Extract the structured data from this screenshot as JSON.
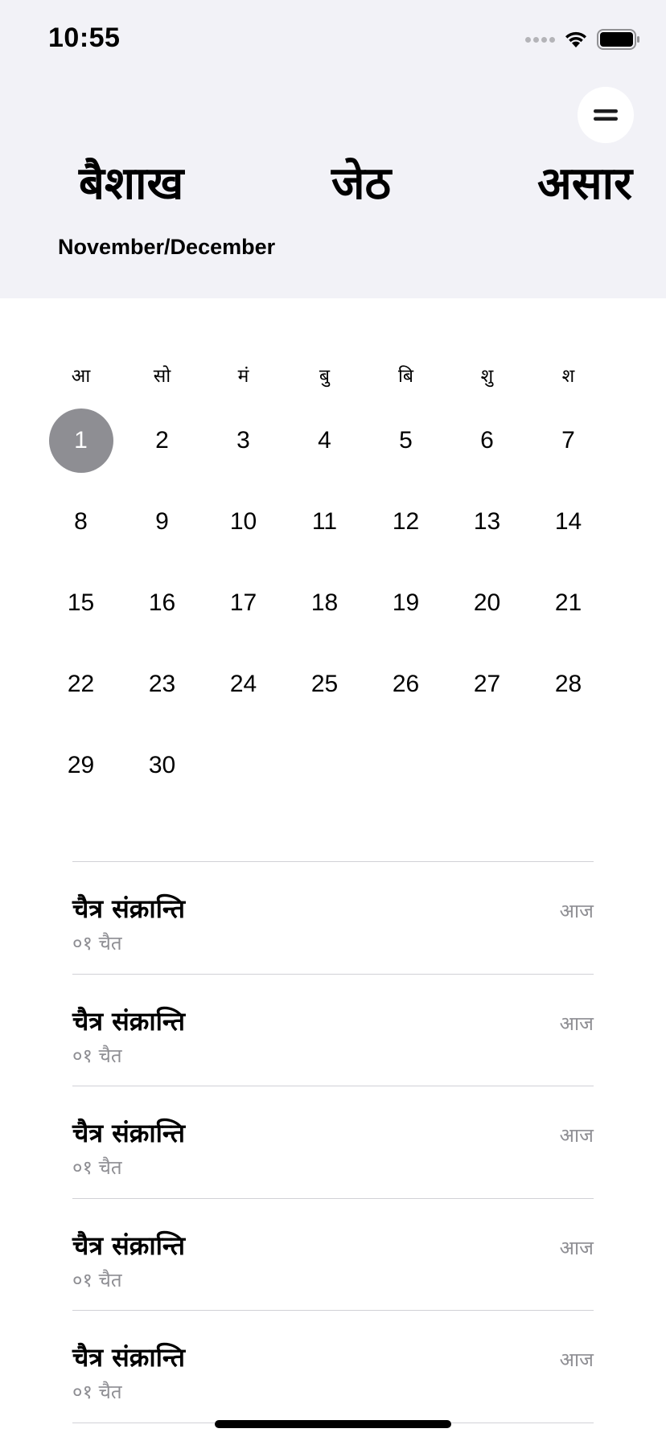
{
  "status_bar": {
    "time": "10:55",
    "icons": [
      "cellular-signal-icon",
      "wifi-icon",
      "battery-icon"
    ]
  },
  "header": {
    "menu_icon": "menu-icon",
    "months": [
      "बैशाख",
      "जेठ",
      "असार"
    ],
    "subtitle": "November/December"
  },
  "calendar": {
    "weekdays": [
      "आ",
      "सो",
      "मं",
      "बु",
      "बि",
      "शु",
      "श"
    ],
    "days": [
      "1",
      "2",
      "3",
      "4",
      "5",
      "6",
      "7",
      "8",
      "9",
      "10",
      "11",
      "12",
      "13",
      "14",
      "15",
      "16",
      "17",
      "18",
      "19",
      "20",
      "21",
      "22",
      "23",
      "24",
      "25",
      "26",
      "27",
      "28",
      "29",
      "30"
    ],
    "selected_day": "1",
    "selected_color": "#8e8e93"
  },
  "events": [
    {
      "title": "चैत्र संक्रान्ति",
      "date": "०१ चैत",
      "tag": "आज"
    },
    {
      "title": "चैत्र संक्रान्ति",
      "date": "०१ चैत",
      "tag": "आज"
    },
    {
      "title": "चैत्र संक्रान्ति",
      "date": "०१ चैत",
      "tag": "आज"
    },
    {
      "title": "चैत्र संक्रान्ति",
      "date": "०१ चैत",
      "tag": "आज"
    },
    {
      "title": "चैत्र संक्रान्ति",
      "date": "०१ चैत",
      "tag": "आज"
    }
  ],
  "colors": {
    "header_background": "#f2f2f7",
    "secondary_text": "#8e8e93",
    "divider": "#d1d1d6"
  }
}
